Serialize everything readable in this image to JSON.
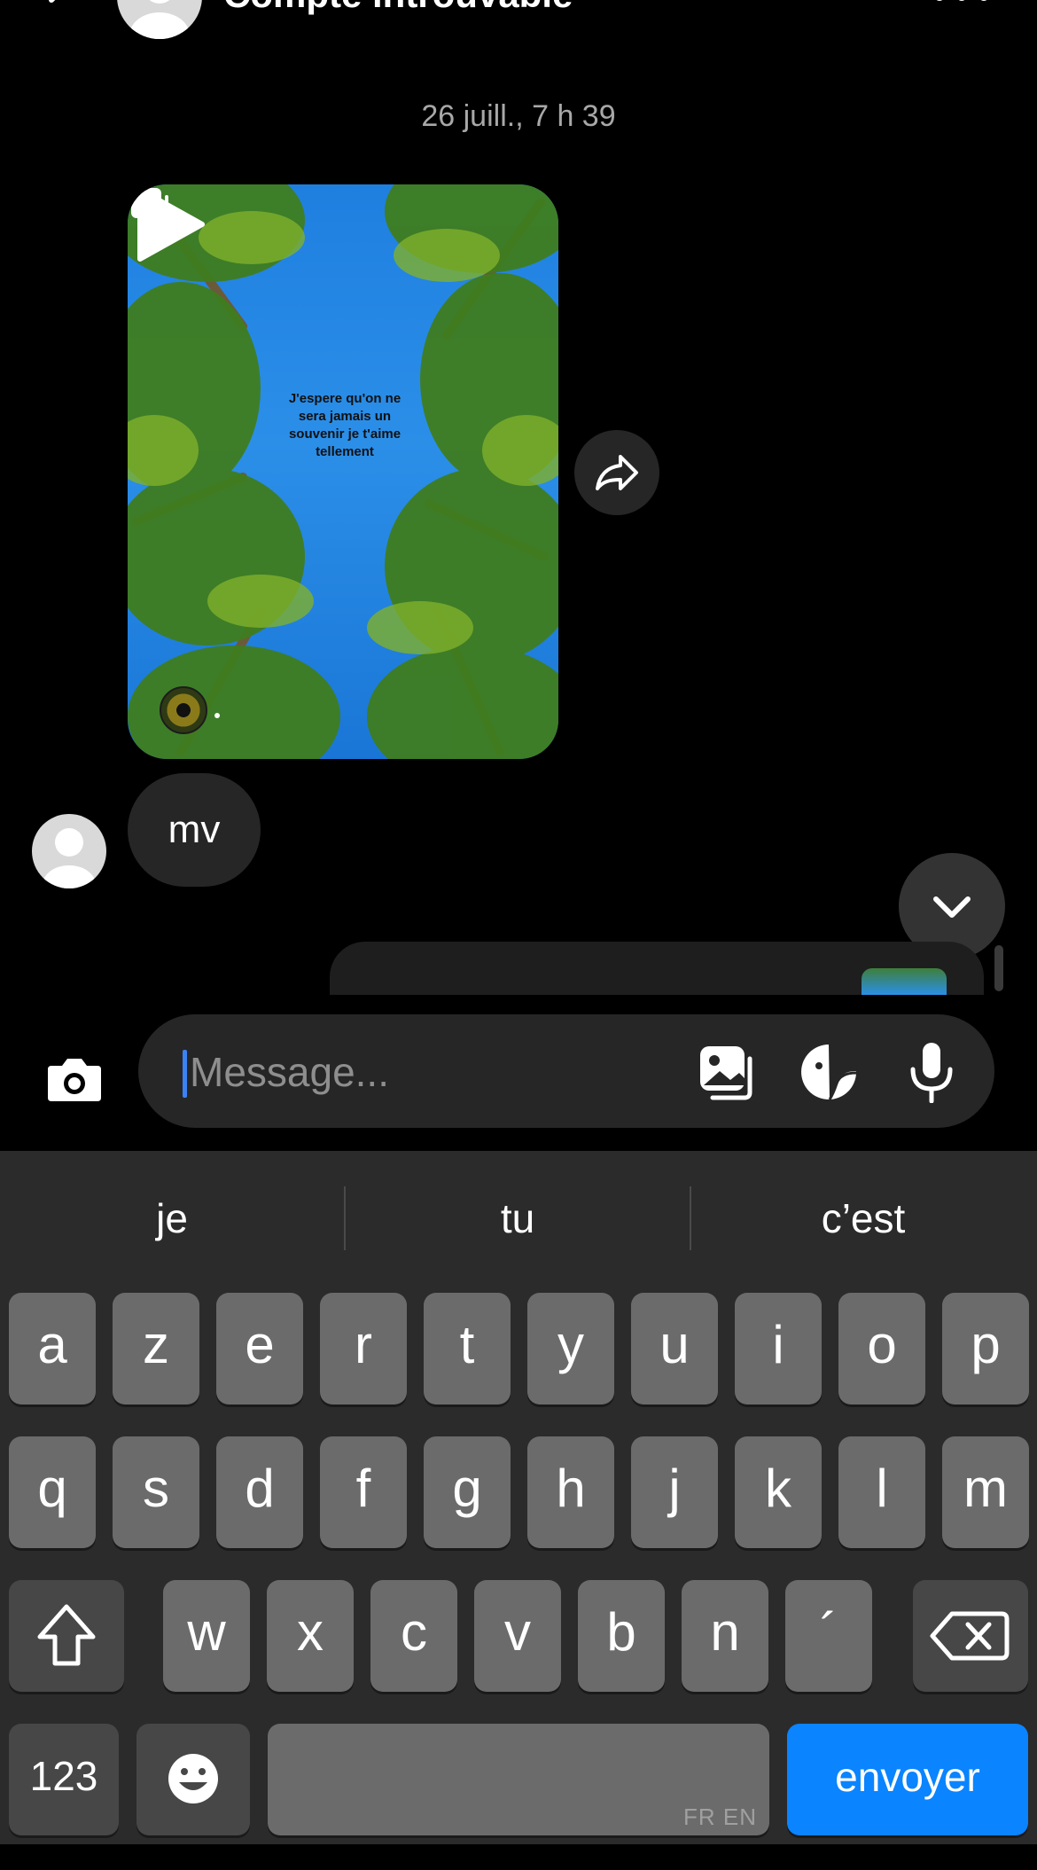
{
  "header": {
    "title": "Compte introuvable"
  },
  "thread": {
    "timestamp": "26 juill., 7 h 39",
    "reel": {
      "overlay_text": "J'espere qu'on ne sera jamais un souvenir je t'aime tellement"
    },
    "message": {
      "text": "mv"
    }
  },
  "composer": {
    "placeholder": "Message..."
  },
  "keyboard": {
    "suggestions": [
      "je",
      "tu",
      "c’est"
    ],
    "row1": [
      "a",
      "z",
      "e",
      "r",
      "t",
      "y",
      "u",
      "i",
      "o",
      "p"
    ],
    "row2": [
      "q",
      "s",
      "d",
      "f",
      "g",
      "h",
      "j",
      "k",
      "l",
      "m"
    ],
    "row3": [
      "w",
      "x",
      "c",
      "v",
      "b",
      "n",
      "´"
    ],
    "numbers_label": "123",
    "space_languages": "FR EN",
    "send_label": "envoyer"
  },
  "colors": {
    "background": "#000000",
    "bubble": "#262626",
    "key": "#6b6b6b",
    "send": "#0a84ff",
    "caret": "#3b82f6"
  }
}
